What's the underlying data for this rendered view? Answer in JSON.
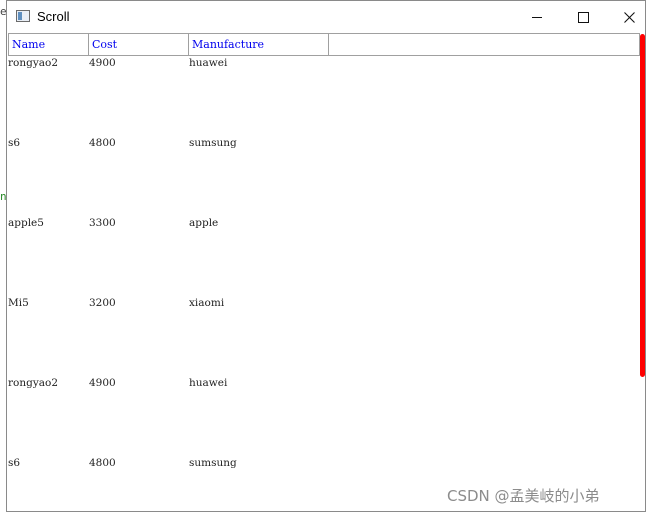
{
  "window": {
    "title": "Scroll",
    "icon": "window-app-icon",
    "controls": {
      "minimize": "minimize-icon",
      "maximize": "maximize-icon",
      "close": "close-icon"
    }
  },
  "table": {
    "header_color": "#0000ee",
    "columns": [
      "Name",
      "Cost",
      "Manufacture",
      ""
    ],
    "rows": [
      [
        "rongyao2",
        "4900",
        "huawei"
      ],
      [
        "s6",
        "4800",
        "sumsung"
      ],
      [
        "apple5",
        "3300",
        "apple"
      ],
      [
        "Mi5",
        "3200",
        "xiaomi"
      ],
      [
        "rongyao2",
        "4900",
        "huawei"
      ],
      [
        "s6",
        "4800",
        "sumsung"
      ]
    ]
  },
  "scroll_indicator_color": "#ff0000",
  "background_fragments": {
    "top_char": "e",
    "mid_char": "n"
  },
  "watermark": "CSDN @孟美岐的小弟"
}
